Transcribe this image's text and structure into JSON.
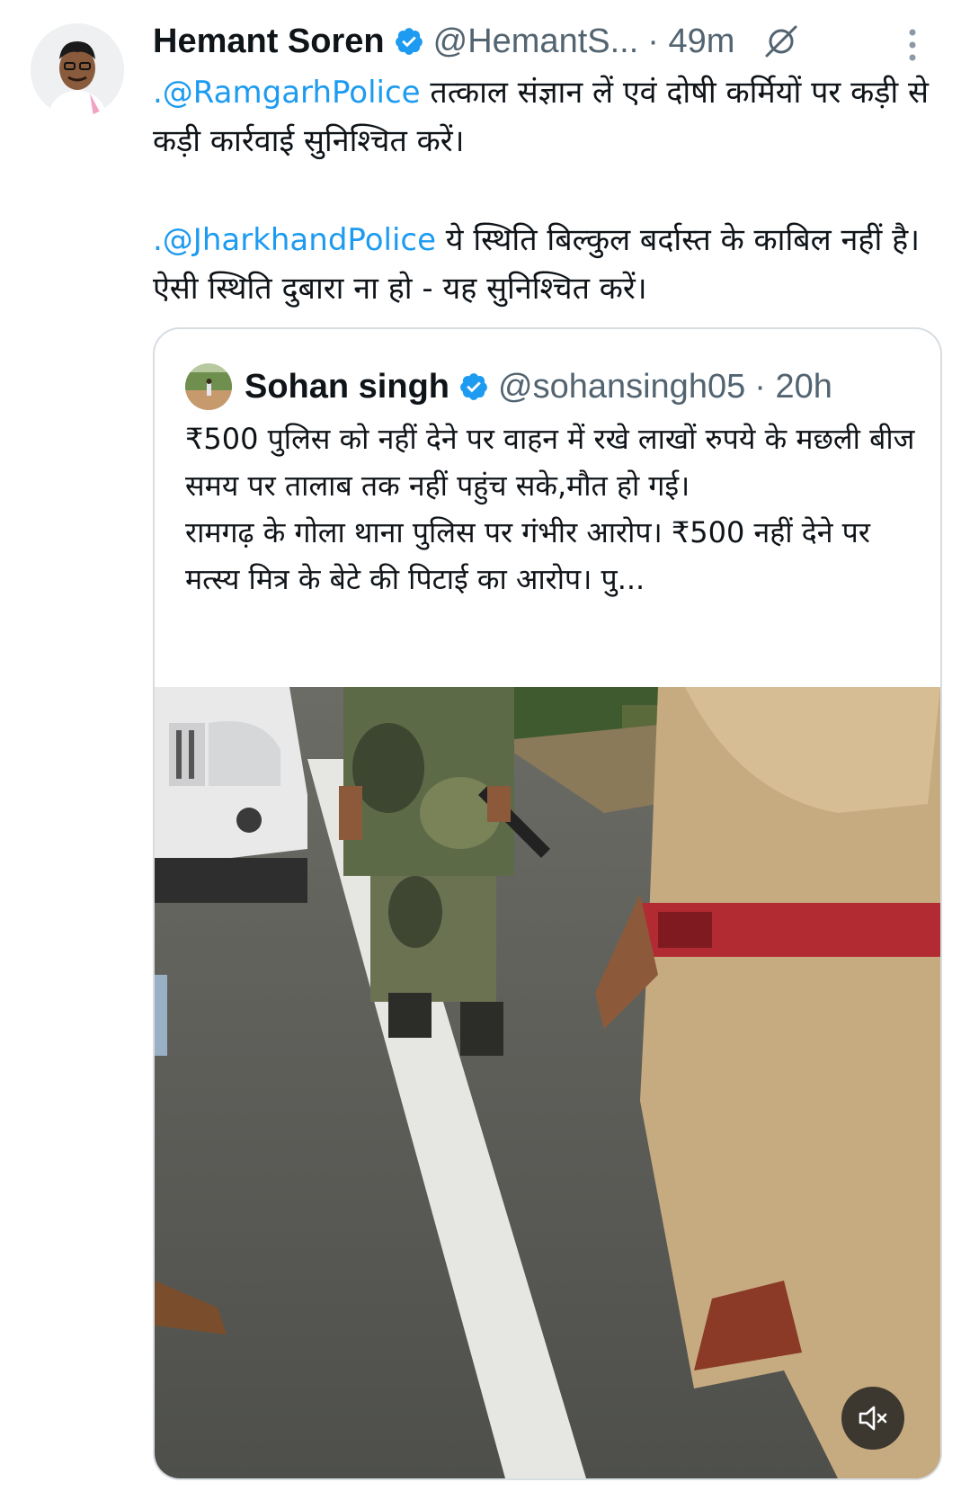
{
  "tweet": {
    "author_name": "Hemant Soren",
    "handle": "@HemantS...",
    "time": "· 49m",
    "paragraph1_mention": ".@RamgarhPolice",
    "paragraph1_text": " तत्काल संज्ञान लें एवं दोषी कर्मियों पर कड़ी से कड़ी कार्रवाई सुनिश्चित करें।",
    "paragraph2_mention": ".@JharkhandPolice",
    "paragraph2_text": " ये स्थिति बिल्कुल बर्दास्त के काबिल नहीं है। ऐसी स्थिति दुबारा ना हो - यह सुनिश्चित करें।"
  },
  "quoted_tweet": {
    "author_name": "Sohan singh",
    "handle": "@sohansingh05",
    "time": "· 20h",
    "line1": "₹500 पुलिस को नहीं देने पर वाहन में रखे लाखों रुपये के मछली बीज समय पर तालाब तक नहीं पहुंच सके,मौत हो गई।",
    "line2": "रामगढ़ के गोला थाना पुलिस पर गंभीर आरोप। ₹500 नहीं देने पर मत्स्य मित्र के बेटे की पिटाई का आरोप। पु..."
  },
  "icons": {
    "verified": "verified-badge-icon",
    "grok": "grok-icon",
    "more": "more-vertical-icon",
    "mute": "speaker-muted-icon"
  },
  "colors": {
    "accent": "#1d9bf0",
    "secondary_text": "#536471",
    "primary_text": "#0f1419",
    "border": "#d8dde2"
  }
}
